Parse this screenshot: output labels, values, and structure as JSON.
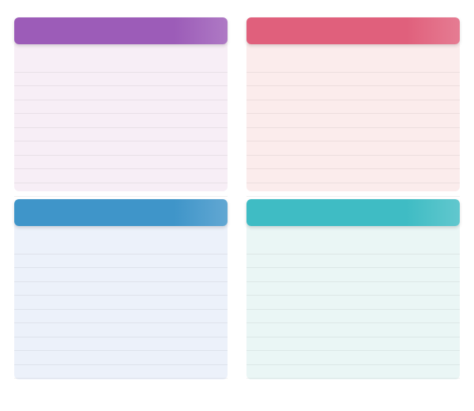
{
  "page": {
    "title": "",
    "footnote": ""
  },
  "panels": [
    {
      "title": "",
      "value": "",
      "header_color": "#9c5cb8",
      "body_color": "#f7eef6",
      "columns": [
        "",
        "",
        "",
        ""
      ],
      "rows": [
        {
          "rank": "",
          "name": "",
          "val1": "",
          "val2": ""
        },
        {
          "rank": "",
          "name": "",
          "val1": "",
          "val2": ""
        },
        {
          "rank": "",
          "name": "",
          "val1": "",
          "val2": ""
        },
        {
          "rank": "",
          "name": "",
          "val1": "",
          "val2": ""
        },
        {
          "rank": "",
          "name": "",
          "val1": "",
          "val2": ""
        },
        {
          "rank": "",
          "name": "",
          "val1": "",
          "val2": ""
        },
        {
          "rank": "",
          "name": "",
          "val1": "",
          "val2": ""
        },
        {
          "rank": "",
          "name": "",
          "val1": "",
          "val2": ""
        },
        {
          "rank": "",
          "name": "",
          "val1": "",
          "val2": ""
        },
        {
          "rank": "",
          "name": "",
          "val1": "",
          "val2": ""
        }
      ]
    },
    {
      "title": "",
      "value": "",
      "header_color": "#e0607c",
      "body_color": "#fbecec",
      "columns": [
        "",
        "",
        "",
        ""
      ],
      "rows": [
        {
          "rank": "",
          "name": "",
          "val1": "",
          "val2": ""
        },
        {
          "rank": "",
          "name": "",
          "val1": "",
          "val2": ""
        },
        {
          "rank": "",
          "name": "",
          "val1": "",
          "val2": ""
        },
        {
          "rank": "",
          "name": "",
          "val1": "",
          "val2": ""
        },
        {
          "rank": "",
          "name": "",
          "val1": "",
          "val2": ""
        },
        {
          "rank": "",
          "name": "",
          "val1": "",
          "val2": ""
        },
        {
          "rank": "",
          "name": "",
          "val1": "",
          "val2": ""
        },
        {
          "rank": "",
          "name": "",
          "val1": "",
          "val2": ""
        },
        {
          "rank": "",
          "name": "",
          "val1": "",
          "val2": ""
        },
        {
          "rank": "",
          "name": "",
          "val1": "",
          "val2": ""
        }
      ]
    },
    {
      "title": "",
      "value": "",
      "header_color": "#3f95c9",
      "body_color": "#ecf1fa",
      "columns": [
        "",
        "",
        "",
        ""
      ],
      "rows": [
        {
          "rank": "",
          "name": "",
          "val1": "",
          "val2": ""
        },
        {
          "rank": "",
          "name": "",
          "val1": "",
          "val2": ""
        },
        {
          "rank": "",
          "name": "",
          "val1": "",
          "val2": ""
        },
        {
          "rank": "",
          "name": "",
          "val1": "",
          "val2": ""
        },
        {
          "rank": "",
          "name": "",
          "val1": "",
          "val2": ""
        },
        {
          "rank": "",
          "name": "",
          "val1": "",
          "val2": ""
        },
        {
          "rank": "",
          "name": "",
          "val1": "",
          "val2": ""
        },
        {
          "rank": "",
          "name": "",
          "val1": "",
          "val2": ""
        },
        {
          "rank": "",
          "name": "",
          "val1": "",
          "val2": ""
        },
        {
          "rank": "",
          "name": "",
          "val1": "",
          "val2": ""
        }
      ]
    },
    {
      "title": "",
      "value": "",
      "header_color": "#3fbcc4",
      "body_color": "#eaf6f5",
      "columns": [
        "",
        "",
        "",
        ""
      ],
      "rows": [
        {
          "rank": "",
          "name": "",
          "val1": "",
          "val2": ""
        },
        {
          "rank": "",
          "name": "",
          "val1": "",
          "val2": ""
        },
        {
          "rank": "",
          "name": "",
          "val1": "",
          "val2": ""
        },
        {
          "rank": "",
          "name": "",
          "val1": "",
          "val2": ""
        },
        {
          "rank": "",
          "name": "",
          "val1": "",
          "val2": ""
        },
        {
          "rank": "",
          "name": "",
          "val1": "",
          "val2": ""
        },
        {
          "rank": "",
          "name": "",
          "val1": "",
          "val2": ""
        },
        {
          "rank": "",
          "name": "",
          "val1": "",
          "val2": ""
        },
        {
          "rank": "",
          "name": "",
          "val1": "",
          "val2": ""
        },
        {
          "rank": "",
          "name": "",
          "val1": "",
          "val2": ""
        }
      ]
    }
  ]
}
